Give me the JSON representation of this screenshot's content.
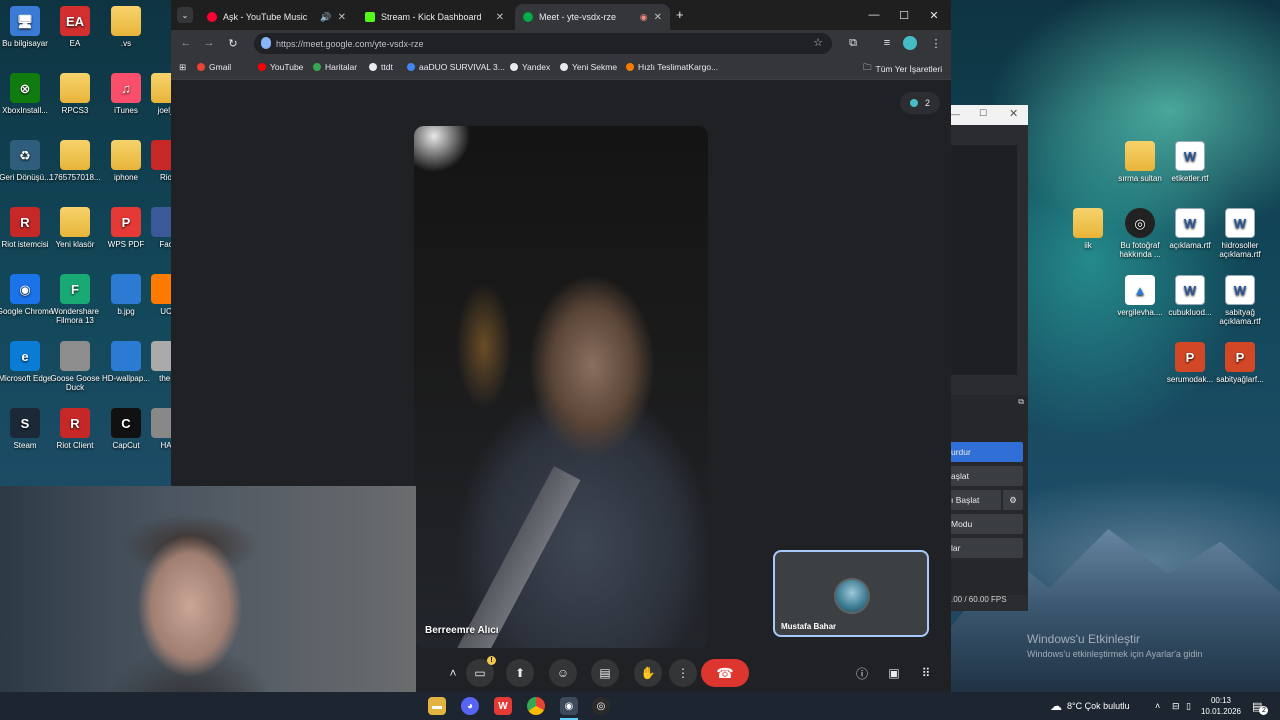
{
  "desktop": {
    "icons_left": [
      {
        "label": "Bu bilgisayar",
        "glyph": "🖥"
      },
      {
        "label": "EA",
        "glyph": "EA"
      },
      {
        "label": ".vs",
        "glyph": ""
      },
      {
        "label": "XboxInstall...",
        "glyph": "⊗"
      },
      {
        "label": "RPCS3",
        "glyph": ""
      },
      {
        "label": "iTunes",
        "glyph": "♫"
      },
      {
        "label": "joel_",
        "glyph": ""
      },
      {
        "label": "Geri Dönüşü...",
        "glyph": "♻"
      },
      {
        "label": "1765757018...",
        "glyph": ""
      },
      {
        "label": "iphone",
        "glyph": ""
      },
      {
        "label": "Rio",
        "glyph": ""
      },
      {
        "label": "Riot istemcisi",
        "glyph": "R"
      },
      {
        "label": "Yeni klasör",
        "glyph": ""
      },
      {
        "label": "WPS PDF",
        "glyph": "P"
      },
      {
        "label": "Fac",
        "glyph": ""
      },
      {
        "label": "Google Chrome",
        "glyph": "◉"
      },
      {
        "label": "Wondershare Filmora 13",
        "glyph": "F"
      },
      {
        "label": "b.jpg",
        "glyph": ""
      },
      {
        "label": "UC",
        "glyph": ""
      },
      {
        "label": "Microsoft Edge",
        "glyph": "e"
      },
      {
        "label": "Goose Goose Duck",
        "glyph": ""
      },
      {
        "label": "HD-wallpap...",
        "glyph": ""
      },
      {
        "label": "the-",
        "glyph": ""
      },
      {
        "label": "Steam",
        "glyph": "S"
      },
      {
        "label": "Riot Client",
        "glyph": "R"
      },
      {
        "label": "CapCut",
        "glyph": "C"
      },
      {
        "label": "HA",
        "glyph": ""
      }
    ],
    "icons_right": [
      {
        "label": "sırma sultan"
      },
      {
        "label": "etiketler.rtf"
      },
      {
        "label": "iik"
      },
      {
        "label": "Bu fotoğraf hakkında ..."
      },
      {
        "label": "açıklama.rtf"
      },
      {
        "label": "hidrosoller açıklama.rtf"
      },
      {
        "label": "vergilevha...."
      },
      {
        "label": "cubukluod..."
      },
      {
        "label": "sabityağ açıklama.rtf"
      },
      {
        "label": "serumodak..."
      },
      {
        "label": "sabityağlarf..."
      }
    ],
    "activation_title": "Windows'u Etkinleştir",
    "activation_sub": "Windows'u etkinleştirmek için Ayarlar'a gidin"
  },
  "browser": {
    "tabs": [
      {
        "title": "Aşk - YouTube Music",
        "color": "#ff0033",
        "extra": "🔊"
      },
      {
        "title": "Stream - Kick Dashboard",
        "color": "#53fc18",
        "extra": ""
      },
      {
        "title": "Meet - yte-vsdx-rze",
        "color": "#00ac47",
        "extra": "◉"
      }
    ],
    "new_tab": "+",
    "url": "https://meet.google.com/yte-vsdx-rze",
    "bookmarks": [
      {
        "label": "Gmail",
        "color": "#ea4335"
      },
      {
        "label": "YouTube",
        "color": "#ff0000"
      },
      {
        "label": "Haritalar",
        "color": "#34a853"
      },
      {
        "label": "ttdt",
        "color": "#e8eaed"
      },
      {
        "label": "aaDUO SURVIVAL 3...",
        "color": "#4285f4"
      },
      {
        "label": "Yandex",
        "color": "#e8eaed"
      },
      {
        "label": "Yeni Sekme",
        "color": "#e8eaed"
      },
      {
        "label": "Hızlı TeslimatKargo...",
        "color": "#f57c00"
      }
    ],
    "all_bookmarks": "Tüm Yer İşaretleri"
  },
  "meet": {
    "participant_count": "2",
    "main_speaker": "Berreemre Alıcı",
    "self_name": "Mustafa Bahar",
    "controls": {
      "more_options": "⋮",
      "end_call": "☎"
    }
  },
  "obs": {
    "buttons": [
      "urdurr",
      "aşlat",
      "ı Başlat",
      "Modu",
      "lar"
    ],
    "buttons_display": [
      "urdur",
      "aşlat",
      "ı Başlat",
      "Modu",
      "lar"
    ],
    "fps": ".00 / 60.00 FPS"
  },
  "taskbar": {
    "weather": "8°C  Çok bulutlu",
    "time": "00:13",
    "date": "10.01.2026",
    "notifications": "2"
  }
}
